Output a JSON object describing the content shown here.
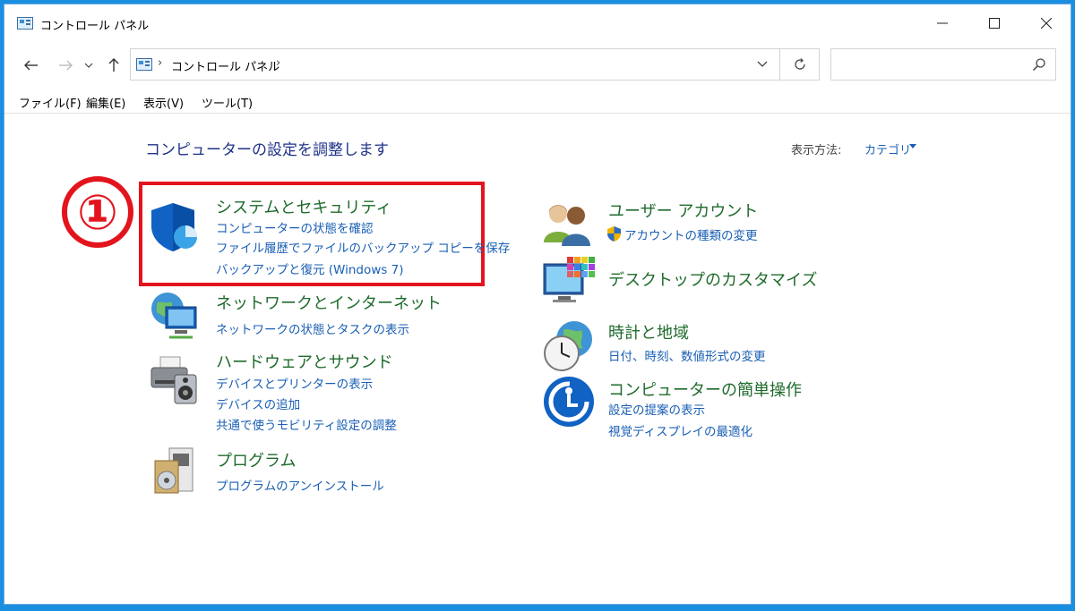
{
  "window": {
    "title": "コントロール パネル",
    "controls": {
      "minimize": "minimize-icon",
      "maximize": "maximize-icon",
      "close": "close-icon"
    }
  },
  "nav": {
    "back_icon": "back-arrow-icon",
    "forward_icon": "forward-arrow-icon",
    "recent_icon": "chevron-down-icon",
    "up_icon": "up-arrow-icon",
    "breadcrumb": "コントロール パネル",
    "refresh_icon": "refresh-icon",
    "search_placeholder": "",
    "search_icon": "search-icon"
  },
  "menu": [
    "ファイル(F)",
    "編集(E)",
    "表示(V)",
    "ツール(T)"
  ],
  "content": {
    "heading": "コンピューターの設定を調整します",
    "view_by_label": "表示方法:",
    "view_by_value": "カテゴリ",
    "marker": "①"
  },
  "categories": {
    "system": {
      "title": "システムとセキュリティ",
      "links": [
        "コンピューターの状態を確認",
        "ファイル履歴でファイルのバックアップ コピーを保存",
        "バックアップと復元 (Windows 7)"
      ]
    },
    "network": {
      "title": "ネットワークとインターネット",
      "links": [
        "ネットワークの状態とタスクの表示"
      ]
    },
    "hardware": {
      "title": "ハードウェアとサウンド",
      "links": [
        "デバイスとプリンターの表示",
        "デバイスの追加",
        "共通で使うモビリティ設定の調整"
      ]
    },
    "programs": {
      "title": "プログラム",
      "links": [
        "プログラムのアンインストール"
      ]
    },
    "users": {
      "title": "ユーザー アカウント",
      "links": [
        "アカウントの種類の変更"
      ]
    },
    "appearance": {
      "title": "デスクトップのカスタマイズ",
      "links": []
    },
    "clock": {
      "title": "時計と地域",
      "links": [
        "日付、時刻、数値形式の変更"
      ]
    },
    "ease": {
      "title": "コンピューターの簡単操作",
      "links": [
        "設定の提案の表示",
        "視覚ディスプレイの最適化"
      ]
    }
  },
  "colors": {
    "accent_blue": "#1a5fb4",
    "title_green": "#1f6b2c",
    "highlight_red": "#e3141d",
    "desktop": "#1a8fe0"
  }
}
